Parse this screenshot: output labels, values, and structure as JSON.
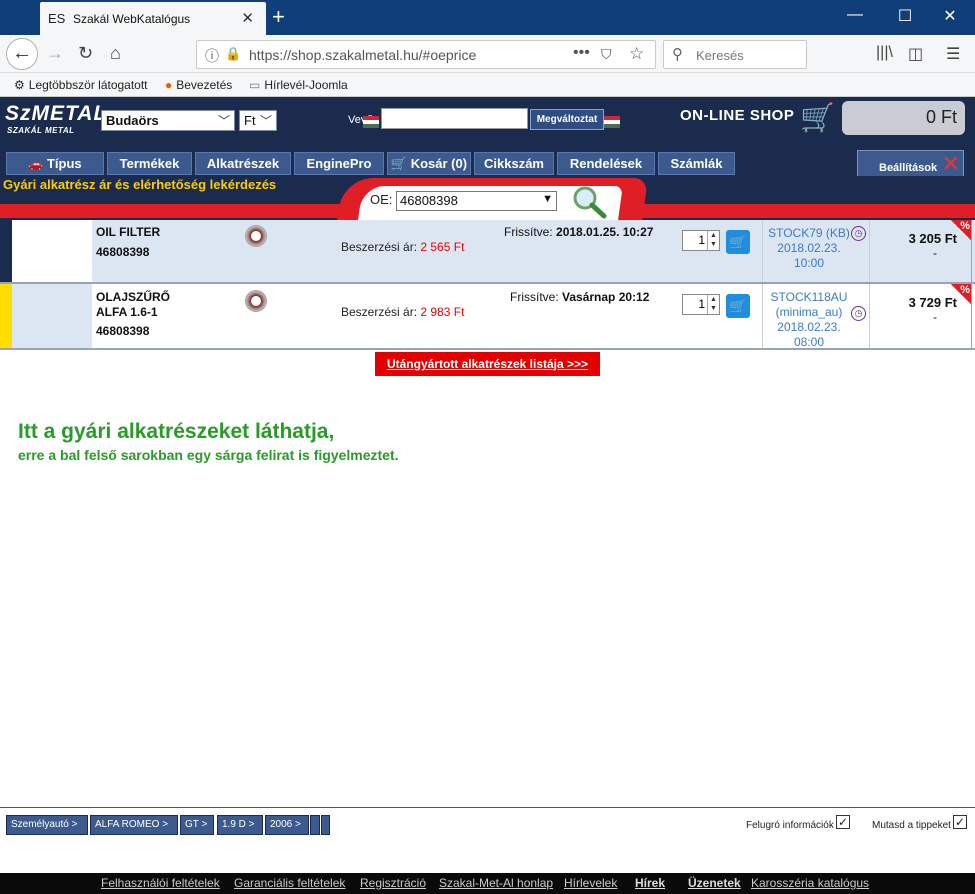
{
  "browser": {
    "tab_icon": "ES",
    "tab_title": "Szakál WebKatalógus",
    "url": "https://shop.szakalmetal.hu/#oeprice",
    "search_placeholder": "Keresés",
    "bookmarks": [
      "Legtöbbször látogatott",
      "Bevezetés",
      "Hírlevél-Joomla"
    ]
  },
  "header": {
    "logo_main": "SzMETAL",
    "logo_sub": "SZAKÁL METAL",
    "location": "Budaörs",
    "currency": "Ft",
    "vevo_label": "Vevő:",
    "change_button": "Megváltoztat",
    "online_shop": "ON-LINE SHOP",
    "cart_total": "0 Ft"
  },
  "menu": {
    "items": [
      "Típus",
      "Termékek",
      "Alkatrészek",
      "EnginePro",
      "Kosár (0)",
      "Cikkszám",
      "Rendelések",
      "Számlák"
    ],
    "settings": "Beállítások"
  },
  "query": {
    "title": "Gyári alkatrész ár és elérhetőség lekérdezés",
    "oe_label": "OE:",
    "oe_value": "46808398"
  },
  "results": [
    {
      "name_line1": "OIL FILTER",
      "name_line2": "",
      "part_no": "46808398",
      "price_label": "Beszerzési ár:",
      "purchase_price": "2 565 Ft",
      "updated_label": "Frissítve:",
      "updated_value": "2018.01.25. 10:27",
      "qty": "1",
      "stock_line1": "STOCK79 (KB)",
      "stock_line2": "2018.02.23.",
      "stock_line3": "10:00",
      "price": "3 205 Ft",
      "dash": "-",
      "badge": "%"
    },
    {
      "name_line1": "OLAJSZŰRŐ",
      "name_line2": "ALFA 1.6-1",
      "part_no": "46808398",
      "price_label": "Beszerzési ár:",
      "purchase_price": "2 983 Ft",
      "updated_label": "Frissítve:",
      "updated_value": "Vasárnap 20:12",
      "qty": "1",
      "stock_line1": "STOCK118AU",
      "stock_line2": "(minima_au)",
      "stock_line3": "2018.02.23.",
      "stock_line4": "08:00",
      "price": "3 729 Ft",
      "dash": "-",
      "badge": "%"
    }
  ],
  "aftermarket_button": "Utángyártott alkatrészek listája >>>",
  "promo": {
    "line1": "Itt a gyári alkatrészeket láthatja,",
    "line2": "erre a bal felső sarokban egy sárga felirat is figyelmeztet."
  },
  "vehicle_path": [
    "Személyautó >",
    "ALFA ROMEO >",
    "GT >",
    "1.9 D >",
    "2006 >"
  ],
  "options": {
    "popup_info": "Felugró információk",
    "show_tips": "Mutasd a tippeket"
  },
  "footer_links": [
    "Felhasználói feltételek",
    "Garanciális feltételek",
    "Regisztráció",
    "Szakal-Met-Al honlap",
    "Hírlevelek",
    "Hírek",
    "Üzenetek",
    "Karosszéria katalógus"
  ],
  "colors": {
    "navy": "#1a2b4e",
    "menu_blue": "#3d5a8e",
    "red": "#e01e25",
    "yellow": "#ffcc00",
    "green": "#2a9a2a",
    "row1_bg": "#dce6f3",
    "row2_bg": "#ffffff",
    "row2_marker": "#ffdd00"
  }
}
